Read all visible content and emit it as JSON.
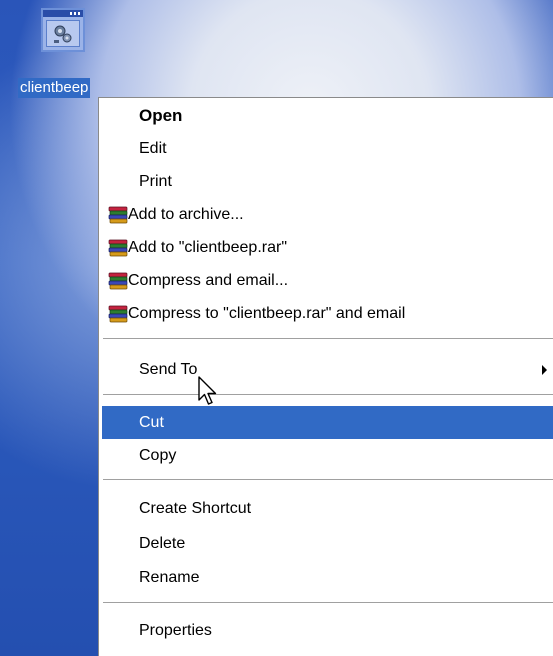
{
  "desktop": {
    "icon": {
      "label": "clientbeep",
      "icon_name": "application-gear-icon"
    }
  },
  "context_menu": {
    "items": [
      {
        "label": "Open",
        "bold": true
      },
      {
        "label": "Edit"
      },
      {
        "label": "Print"
      },
      {
        "label": "Add to archive...",
        "icon": "winrar-books-icon"
      },
      {
        "label": "Add to \"clientbeep.rar\"",
        "icon": "winrar-books-icon"
      },
      {
        "label": "Compress and email...",
        "icon": "winrar-books-icon"
      },
      {
        "label": "Compress to \"clientbeep.rar\" and email",
        "icon": "winrar-books-icon"
      },
      {
        "label": "Send To",
        "submenu": true
      },
      {
        "label": "Cut",
        "highlighted": true
      },
      {
        "label": "Copy"
      },
      {
        "label": "Create Shortcut"
      },
      {
        "label": "Delete"
      },
      {
        "label": "Rename"
      },
      {
        "label": "Properties"
      }
    ]
  },
  "colors": {
    "selection": "#316ac5",
    "desktop": "#2a55b9",
    "menu_background": "#ffffff"
  },
  "cursor": {
    "icon_name": "arrow-cursor-icon"
  }
}
